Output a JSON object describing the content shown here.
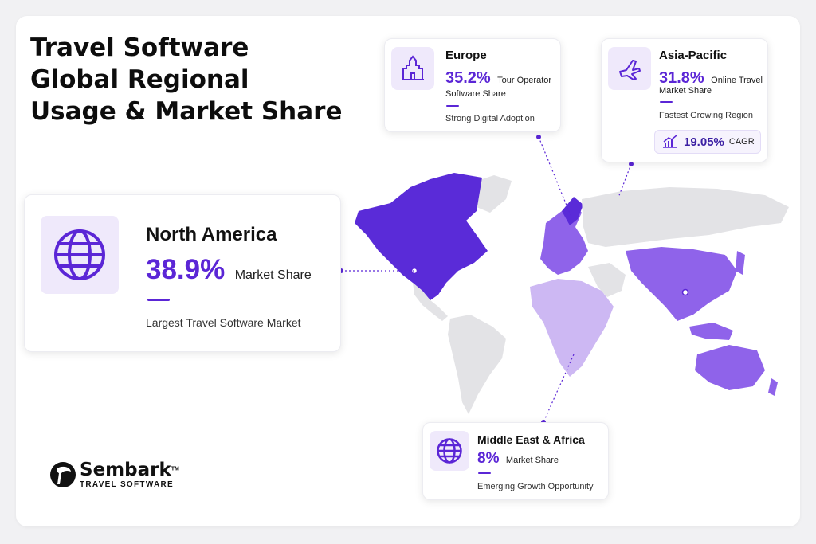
{
  "title": {
    "line1": "Travel Software",
    "line2": "Global Regional",
    "line3": "Usage & Market Share"
  },
  "regions": {
    "north_america": {
      "name": "North America",
      "value": "38.9%",
      "metric": "Market Share",
      "note": "Largest Travel Software Market",
      "icon": "globe-icon"
    },
    "europe": {
      "name": "Europe",
      "value": "35.2%",
      "metric_line1": "Tour Operator",
      "metric_line2": "Software Share",
      "note": "Strong Digital Adoption",
      "icon": "castle-icon"
    },
    "asia_pacific": {
      "name": "Asia-Pacific",
      "value": "31.8%",
      "metric_line1": "Online Travel",
      "metric_line2": "Market Share",
      "note": "Fastest Growing Region",
      "cagr_value": "19.05%",
      "cagr_label": "CAGR",
      "icon": "airplane-icon"
    },
    "mea": {
      "name": "Middle East & Africa",
      "value": "8%",
      "metric": "Market Share",
      "note": "Emerging Growth Opportunity",
      "icon": "globe-icon"
    }
  },
  "logo": {
    "name": "Sembark",
    "trademark": "TM",
    "tagline": "TRAVEL SOFTWARE"
  },
  "colors": {
    "accent": "#5b26d6",
    "highlight_dark": "#5a2bd8",
    "highlight_mid": "#8f63ea",
    "highlight_light": "#cdb8f3",
    "land_grey": "#e3e3e6"
  }
}
